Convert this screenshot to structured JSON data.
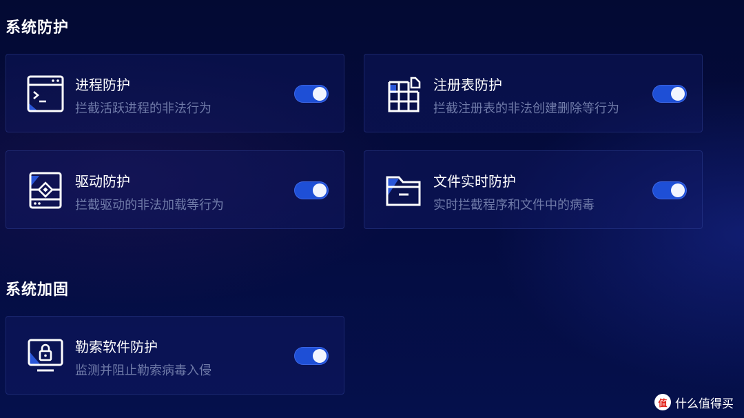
{
  "sections": [
    {
      "title": "系统防护",
      "cards": [
        {
          "title": "进程防护",
          "desc": "拦截活跃进程的非法行为",
          "icon": "terminal-window-icon",
          "enabled": true
        },
        {
          "title": "注册表防护",
          "desc": "拦截注册表的非法创建删除等行为",
          "icon": "registry-grid-icon",
          "enabled": true
        },
        {
          "title": "驱动防护",
          "desc": "拦截驱动的非法加载等行为",
          "icon": "driver-chip-icon",
          "enabled": true
        },
        {
          "title": "文件实时防护",
          "desc": "实时拦截程序和文件中的病毒",
          "icon": "folder-icon",
          "enabled": true
        }
      ]
    },
    {
      "title": "系统加固",
      "cards": [
        {
          "title": "勒索软件防护",
          "desc": "监测并阻止勒索病毒入侵",
          "icon": "monitor-lock-icon",
          "enabled": true
        }
      ]
    }
  ],
  "watermark": {
    "logo": "值",
    "text": "什么值得买"
  },
  "colors": {
    "accent": "#1e4fd6",
    "background": "#040b3e",
    "muted_text": "#6f7aa8"
  }
}
